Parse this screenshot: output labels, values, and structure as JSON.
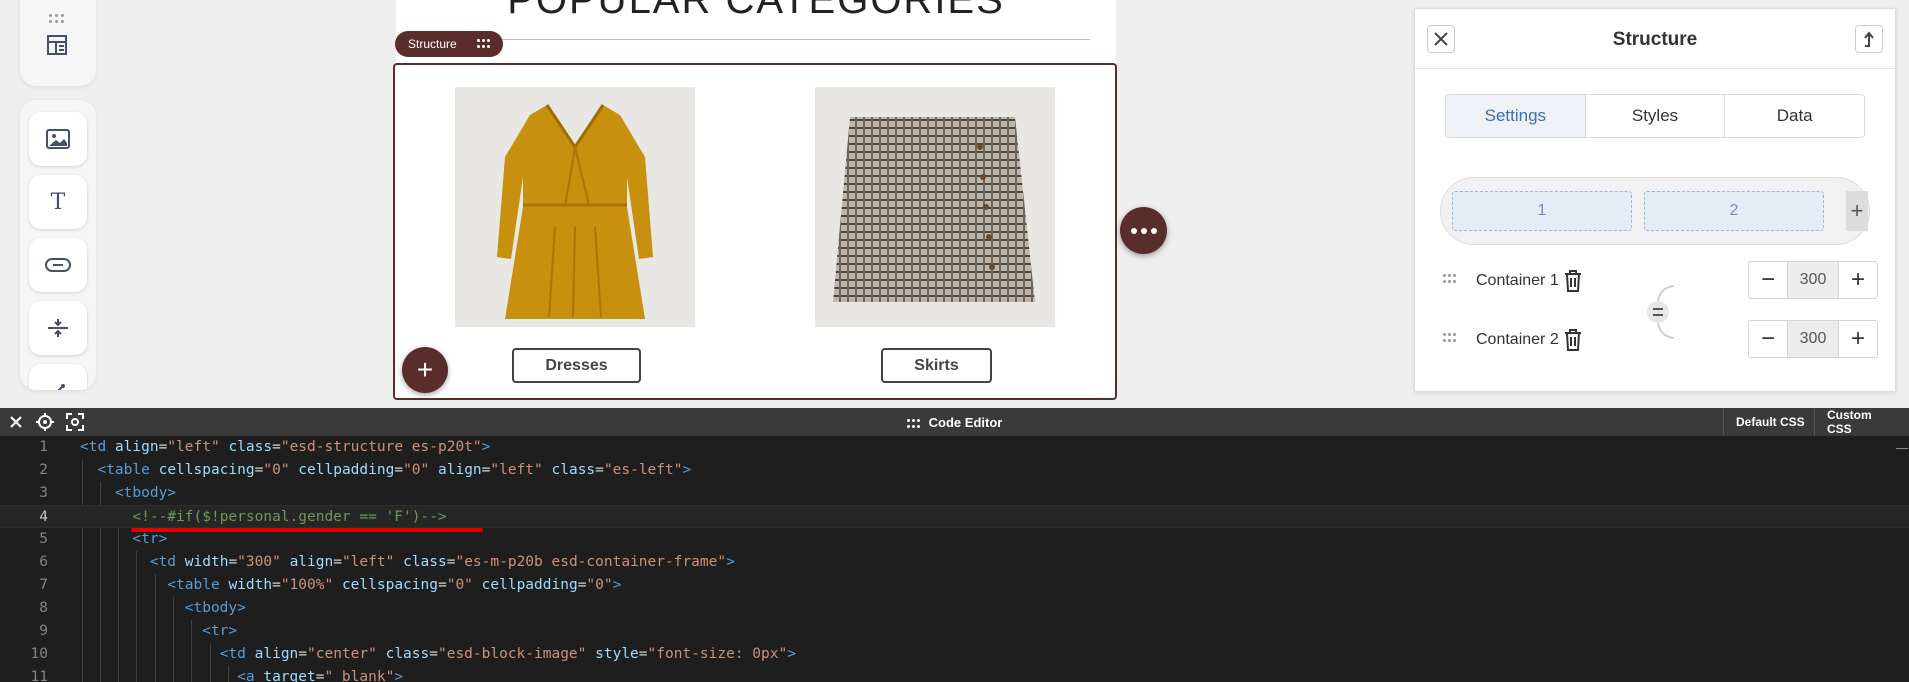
{
  "canvas": {
    "heading": "POPULAR CATEGORIES",
    "structure_tag": "Structure",
    "products": [
      {
        "name": "Dresses"
      },
      {
        "name": "Skirts"
      }
    ],
    "add_block_label": "+"
  },
  "panel": {
    "title": "Structure",
    "tabs": [
      "Settings",
      "Styles",
      "Data"
    ],
    "active_tab": "Settings",
    "columns": [
      "1",
      "2"
    ],
    "add_column_label": "+",
    "containers": [
      {
        "label": "Container 1",
        "width": "300"
      },
      {
        "label": "Container 2",
        "width": "300"
      }
    ],
    "minus_label": "−",
    "plus_label": "+"
  },
  "editor": {
    "title": "Code Editor",
    "default_css_tab": "Default CSS",
    "custom_css_tab": "Custom CSS",
    "line_numbers": [
      "1",
      "2",
      "3",
      "4",
      "5",
      "6",
      "7",
      "8",
      "9",
      "10",
      "11"
    ]
  },
  "colors": {
    "brand": "#5a2d2d",
    "accent": "#3b6fb6",
    "highlight": "#e00000"
  }
}
